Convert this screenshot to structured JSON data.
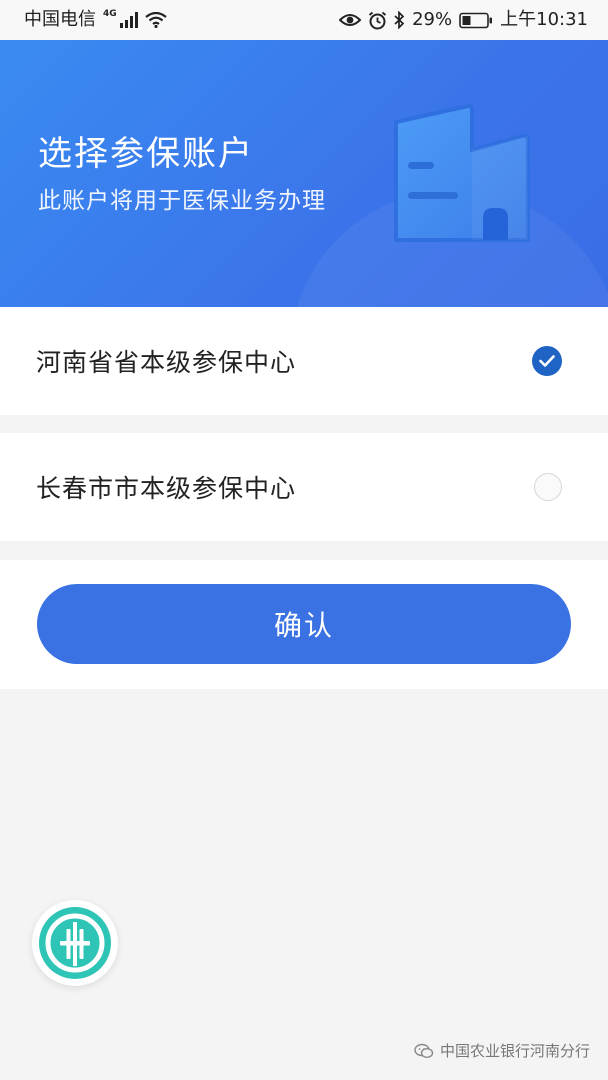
{
  "status_bar": {
    "carrier": "中国电信",
    "network": "4G",
    "battery": "29%",
    "time": "上午10:31",
    "icons": [
      "signal-icon",
      "wifi-icon",
      "eye-icon",
      "alarm-icon",
      "bluetooth-icon",
      "battery-icon"
    ]
  },
  "header": {
    "title": "选择参保账户",
    "subtitle": "此账户将用于医保业务办理",
    "illustration": "building-icon"
  },
  "options": [
    {
      "label": "河南省省本级参保中心",
      "selected": true
    },
    {
      "label": "长春市市本级参保中心",
      "selected": false
    }
  ],
  "confirm_label": "确认",
  "watermark": "中国农业银行河南分行",
  "colors": {
    "brand": "#3a71e3",
    "header_gradient_start": "#3a8bf1",
    "header_gradient_end": "#3a6de6",
    "check": "#1f63c4",
    "logo_teal": "#2ec4b6",
    "background": "#f4f4f4"
  }
}
